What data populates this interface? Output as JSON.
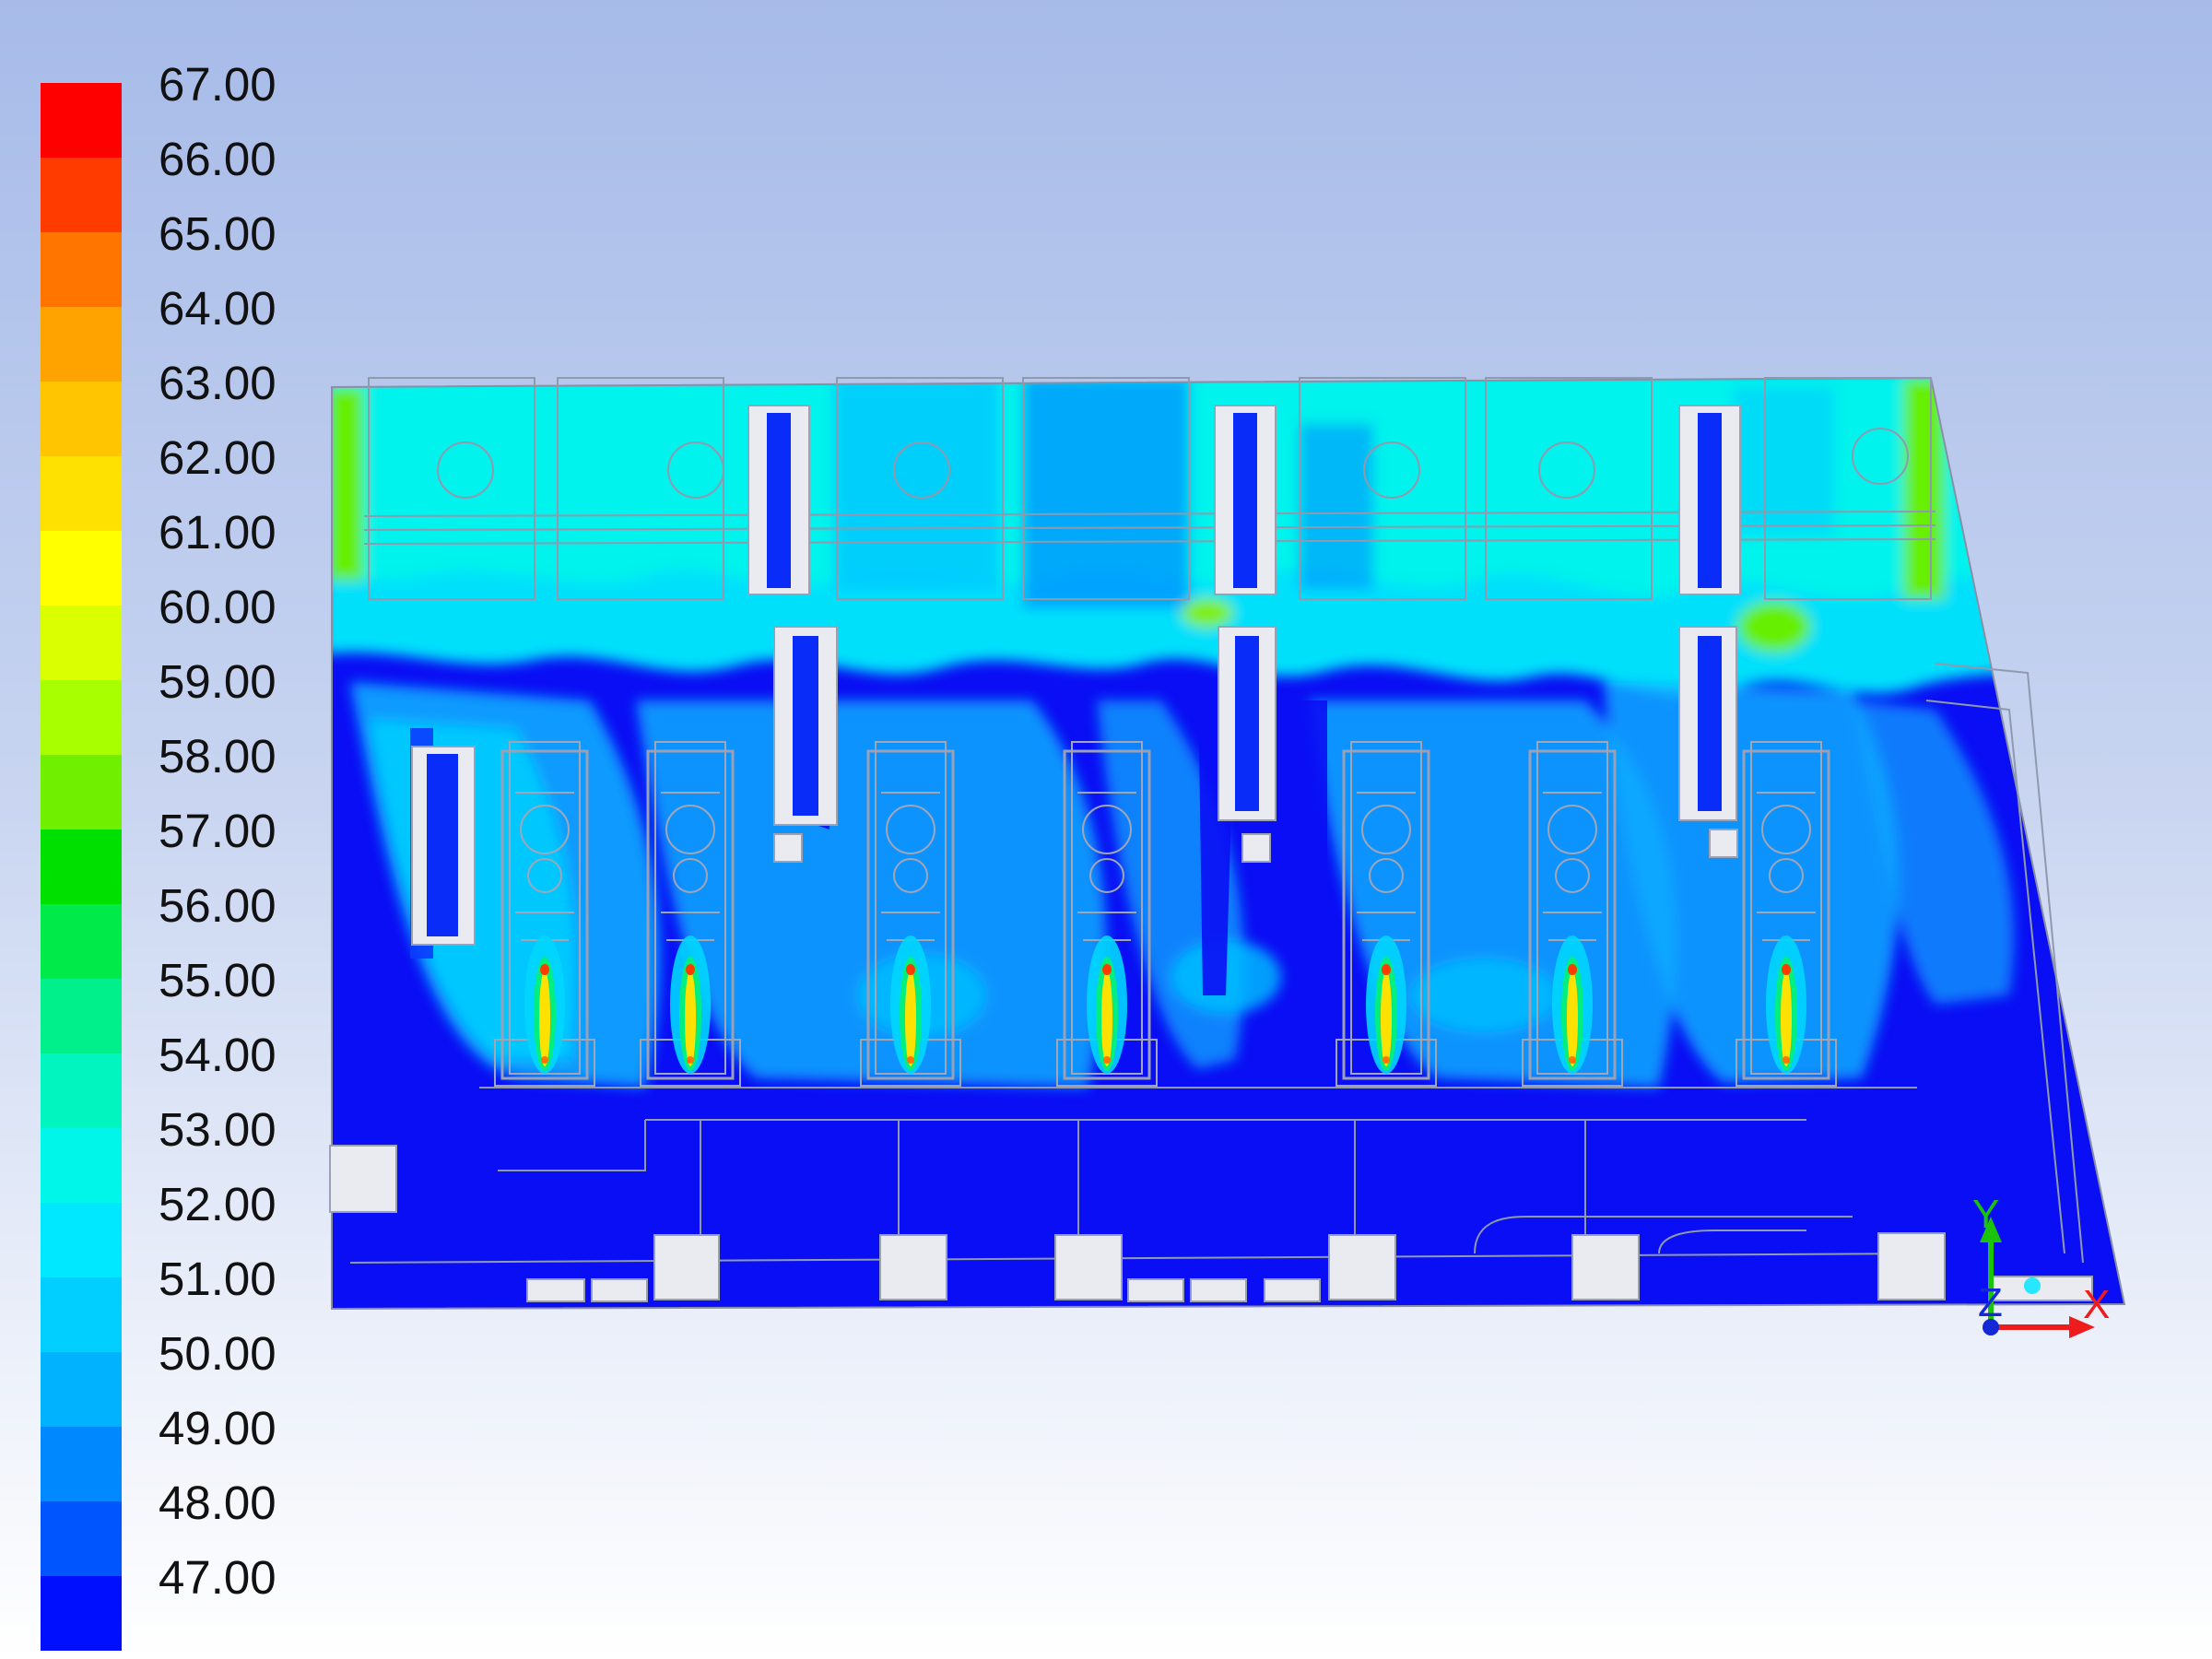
{
  "colormap": {
    "labels": [
      "67.00",
      "66.00",
      "65.00",
      "64.00",
      "63.00",
      "62.00",
      "61.00",
      "60.00",
      "59.00",
      "58.00",
      "57.00",
      "56.00",
      "55.00",
      "54.00",
      "53.00",
      "52.00",
      "51.00",
      "50.00",
      "49.00",
      "48.00",
      "47.00"
    ],
    "colors": [
      "#ff0000",
      "#ff3b00",
      "#ff7500",
      "#ffa300",
      "#ffc600",
      "#ffe100",
      "#ffff00",
      "#d9ff00",
      "#a8ff00",
      "#70ef00",
      "#00e000",
      "#00ea4a",
      "#00f08c",
      "#00f5bf",
      "#00f6e8",
      "#00e8ff",
      "#00cfff",
      "#00b2ff",
      "#0088ff",
      "#0055ff",
      "#0010ff"
    ]
  },
  "scene": {
    "units": [
      "gen-1",
      "gen-2",
      "gen-3",
      "gen-4",
      "gen-5",
      "gen-6",
      "gen-7"
    ]
  },
  "triad": {
    "x_label": "X",
    "y_label": "Y",
    "z_label": "Z"
  }
}
